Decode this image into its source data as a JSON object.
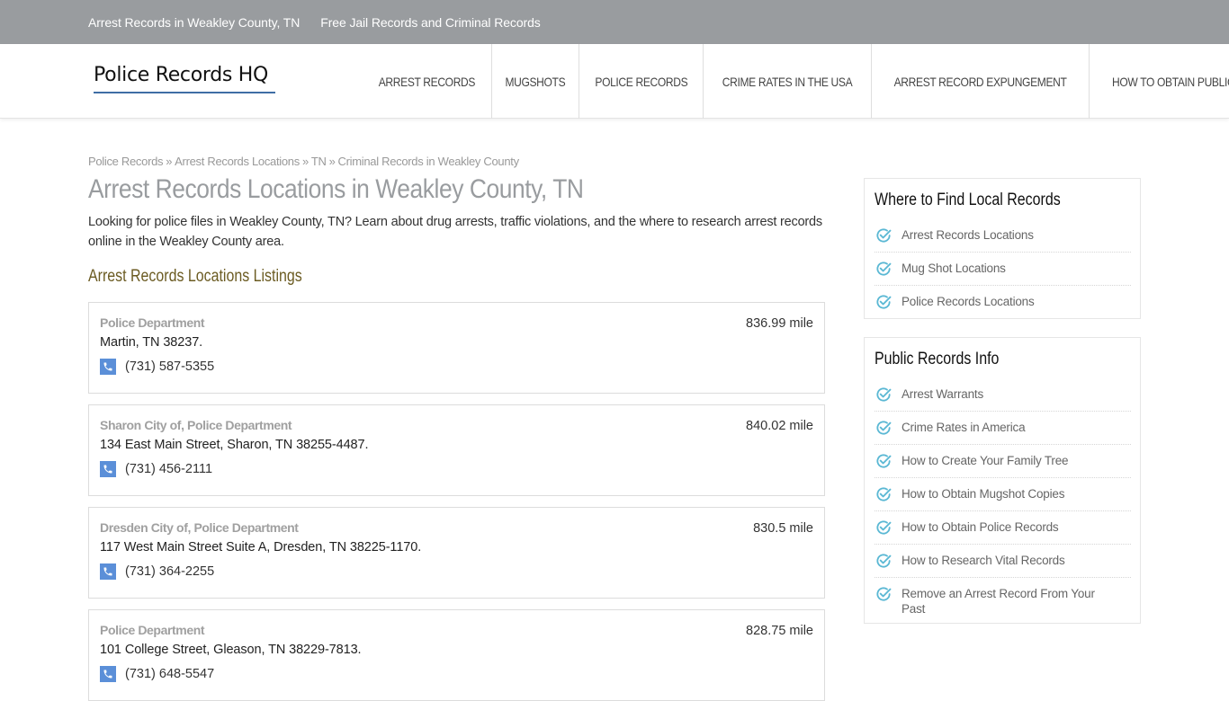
{
  "topbar": {
    "links": [
      "Arrest Records in Weakley County, TN",
      "Free Jail Records and Criminal Records"
    ]
  },
  "header": {
    "logo": "Police Records HQ",
    "nav": [
      "ARREST RECORDS",
      "MUGSHOTS",
      "POLICE RECORDS",
      "CRIME RATES IN THE USA",
      "ARREST RECORD EXPUNGEMENT",
      "HOW TO OBTAIN PUBLIC RECORDS"
    ]
  },
  "breadcrumb": {
    "items": [
      "Police Records",
      "Arrest Records Locations",
      "TN",
      "Criminal Records in Weakley County"
    ],
    "separator": "»"
  },
  "main": {
    "title": "Arrest Records Locations in Weakley County, TN",
    "intro": "Looking for police files in Weakley County, TN? Learn about drug arrests, traffic violations, and the where to research arrest records online in the Weakley County area.",
    "section_title": "Arrest Records Locations Listings",
    "listings": [
      {
        "name": "Police Department",
        "address": "Martin, TN 38237.",
        "phone": "(731) 587-5355",
        "distance": "836.99 mile"
      },
      {
        "name": "Sharon City of, Police Department",
        "address": "134 East Main Street, Sharon, TN 38255-4487.",
        "phone": "(731) 456-2111",
        "distance": "840.02 mile"
      },
      {
        "name": "Dresden City of, Police Department",
        "address": "117 West Main Street Suite A, Dresden, TN 38225-1170.",
        "phone": "(731) 364-2255",
        "distance": "830.5 mile"
      },
      {
        "name": "Police Department",
        "address": "101 College Street, Gleason, TN 38229-7813.",
        "phone": "(731) 648-5547",
        "distance": "828.75 mile"
      }
    ]
  },
  "sidebar": {
    "widgets": [
      {
        "title": "Where to Find Local Records",
        "items": [
          "Arrest Records Locations",
          "Mug Shot Locations",
          "Police Records Locations"
        ]
      },
      {
        "title": "Public Records Info",
        "items": [
          "Arrest Warrants",
          "Crime Rates in America",
          "How to Create Your Family Tree",
          "How to Obtain Mugshot Copies",
          "How to Obtain Police Records",
          "How to Research Vital Records",
          "Remove an Arrest Record From Your Past"
        ]
      }
    ]
  },
  "colors": {
    "topbar_bg": "#999c9f",
    "logo_underline": "#3f6ea5",
    "section_title": "#6b5b22",
    "phone_icon_bg": "#5b8fd8",
    "check_icon": "#5bb8d4"
  },
  "icons": {
    "phone": "phone-icon",
    "check": "check-circle-icon"
  }
}
